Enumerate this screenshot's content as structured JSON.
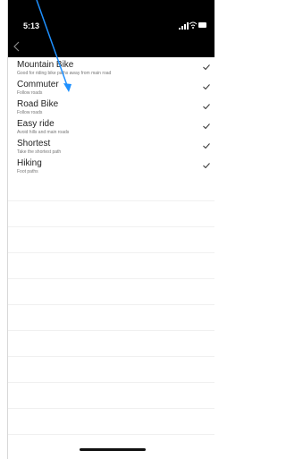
{
  "status_bar": {
    "time": "5:13"
  },
  "options": [
    {
      "title": "Mountain Bike",
      "subtitle": "Good for riding bike paths away from main road"
    },
    {
      "title": "Commuter",
      "subtitle": "Follow roads"
    },
    {
      "title": "Road Bike",
      "subtitle": "Follow roads"
    },
    {
      "title": "Easy ride",
      "subtitle": "Avoid hills and main roads"
    },
    {
      "title": "Shortest",
      "subtitle": "Take the shortest path"
    },
    {
      "title": "Hiking",
      "subtitle": "Foot paths"
    }
  ],
  "icons": {
    "back": "chevron-left-icon",
    "check": "check-icon"
  },
  "colors": {
    "annotation_arrow": "#1e90ff",
    "text": "#222222",
    "subtitle": "#777777"
  }
}
